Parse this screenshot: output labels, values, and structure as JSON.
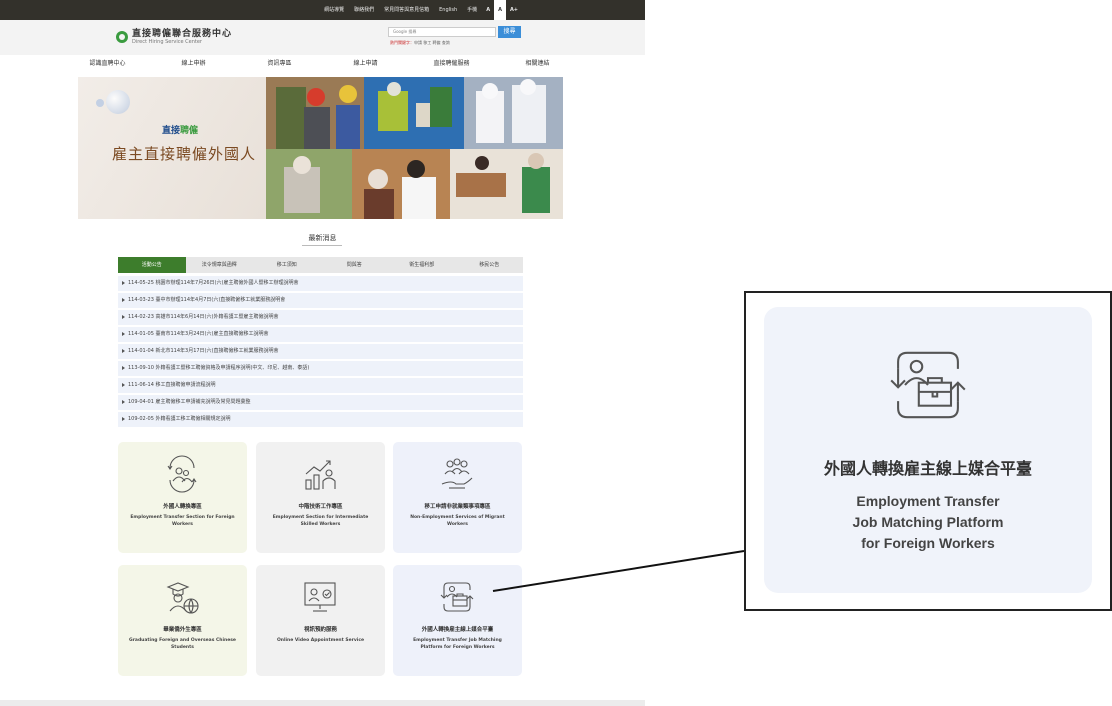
{
  "topbar": {
    "links": [
      "網站導覽",
      "聯絡我們",
      "常見問答與意見信箱",
      "English",
      "手機"
    ],
    "font_sizes": [
      "A",
      "A",
      "A+"
    ]
  },
  "header": {
    "site_name": "直接聘僱聯合服務中心",
    "site_name_en": "Direct Hiring Service Center",
    "search_placeholder": "Google 搜尋",
    "search_button": "搜尋",
    "hot_label": "熱門關鍵字：",
    "hot_keywords": "申請  移工  聘僱  查詢"
  },
  "nav": [
    "認識直聘中心",
    "線上申辦",
    "資訊專區",
    "線上申請",
    "直接聘僱服務",
    "相關連結"
  ],
  "banner": {
    "logo_text": "直接",
    "logo_text2": "聘僱",
    "title": "雇主直接聘僱外國人"
  },
  "news": {
    "title": "最新消息",
    "tabs": [
      "活動公告",
      "法令規章與函釋",
      "移工須知",
      "問與答",
      "衛生福利部",
      "移民公告"
    ],
    "items": [
      "114-05-25 桃園市辦理114年7月26日(六)雇主聘僱外國人暨移工辦理說明會",
      "114-03-23 臺中市辦理114年4月7日(六)直接聘僱移工就業服務說明會",
      "114-02-23 高雄市114年6月14日(六)外籍看護工暨雇主聘僱說明會",
      "114-01-05 臺南市114年3月24日(六)雇主直接聘僱移工說明會",
      "114-01-04 新北市114年3月17日(六)直接聘僱移工就業服務說明會",
      "113-09-10 外籍看護工暨移工聘僱資格及申請程序說明(中文、印尼、越南、泰語)",
      "111-06-14 移工直接聘僱申請流程說明",
      "109-04-01 雇主聘僱移工申請補充說明及常見問題彙整",
      "109-02-05 外籍看護工移工聘僱相關規定說明"
    ]
  },
  "cards": [
    {
      "zh": "外國人轉換專區",
      "en": "Employment Transfer Section for Foreign Workers",
      "icon": "transfer-people-icon"
    },
    {
      "zh": "中階技術工作專區",
      "en": "Employment Section for Intermediate Skilled Workers",
      "icon": "growth-chart-icon"
    },
    {
      "zh": "移工申請非就業類事項專區",
      "en": "Non-Employment Services of Migrant Workers",
      "icon": "group-hand-icon"
    },
    {
      "zh": "畢業僑外生專區",
      "en": "Graduating Foreign and Overseas Chinese Students",
      "icon": "graduate-globe-icon"
    },
    {
      "zh": "視訊預約服務",
      "en": "Online Video Appointment Service",
      "icon": "video-monitor-icon"
    },
    {
      "zh": "外國人轉換雇主線上媒合平臺",
      "en": "Employment Transfer Job Matching Platform for Foreign Workers",
      "icon": "job-matching-icon"
    }
  ],
  "zoom": {
    "zh": "外國人轉換雇主線上媒合平臺",
    "en_line1": "Employment Transfer",
    "en_line2": "Job Matching Platform",
    "en_line3": "for Foreign Workers"
  },
  "colors": {
    "topbar": "#33312b",
    "tab_active": "#3d7d2c",
    "search_button": "#3b8ed8",
    "card_green": "#f4f6e8",
    "card_gray": "#f1f1f1",
    "card_blue": "#eef1fa"
  }
}
